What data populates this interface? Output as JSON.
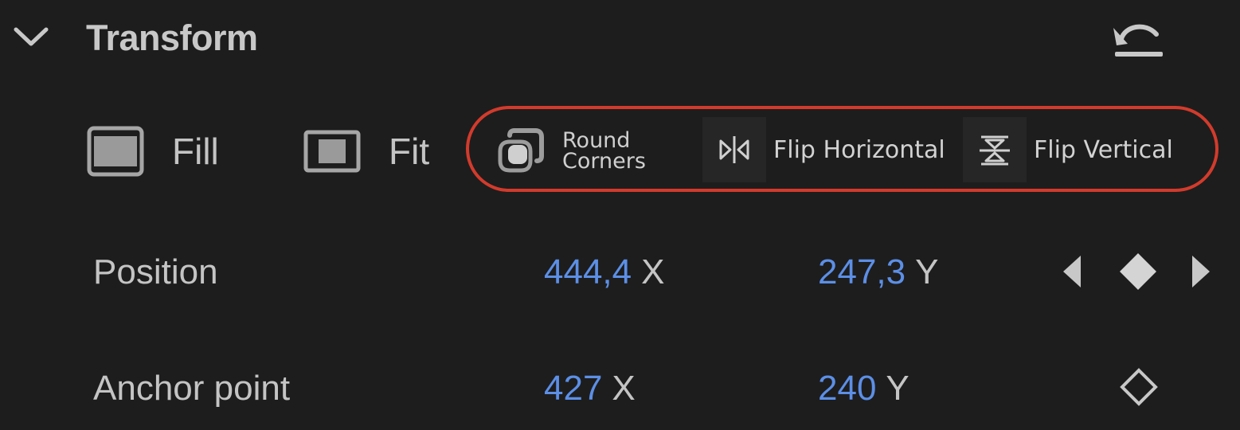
{
  "header": {
    "title": "Transform",
    "collapse_icon": "chevron-down-icon",
    "reset_icon": "reset-undo-icon"
  },
  "scale_modes": {
    "fill": {
      "label": "Fill",
      "icon": "fill-frame-icon"
    },
    "fit": {
      "label": "Fit",
      "icon": "fit-frame-icon"
    }
  },
  "actions": {
    "round_corners": {
      "label_line1": "Round",
      "label_line2": "Corners",
      "icon": "round-corners-icon"
    },
    "flip_horizontal": {
      "label": "Flip Horizontal",
      "icon": "flip-horizontal-icon"
    },
    "flip_vertical": {
      "label": "Flip Vertical",
      "icon": "flip-vertical-icon"
    },
    "highlight_color": "#d23b2c"
  },
  "properties": {
    "position": {
      "label": "Position",
      "x_value": "444,4",
      "x_axis": "X",
      "y_value": "247,3",
      "y_axis": "Y",
      "keyframe_icons": [
        "previous-keyframe-icon",
        "add-keyframe-icon",
        "next-keyframe-icon"
      ]
    },
    "anchor_point": {
      "label": "Anchor point",
      "x_value": "427",
      "x_axis": "X",
      "y_value": "240",
      "y_axis": "Y",
      "keyframe_icon": "keyframe-toggle-icon"
    }
  },
  "colors": {
    "background": "#1d1d1d",
    "value_blue": "#5c8fe6",
    "text": "#c4c4c4"
  }
}
